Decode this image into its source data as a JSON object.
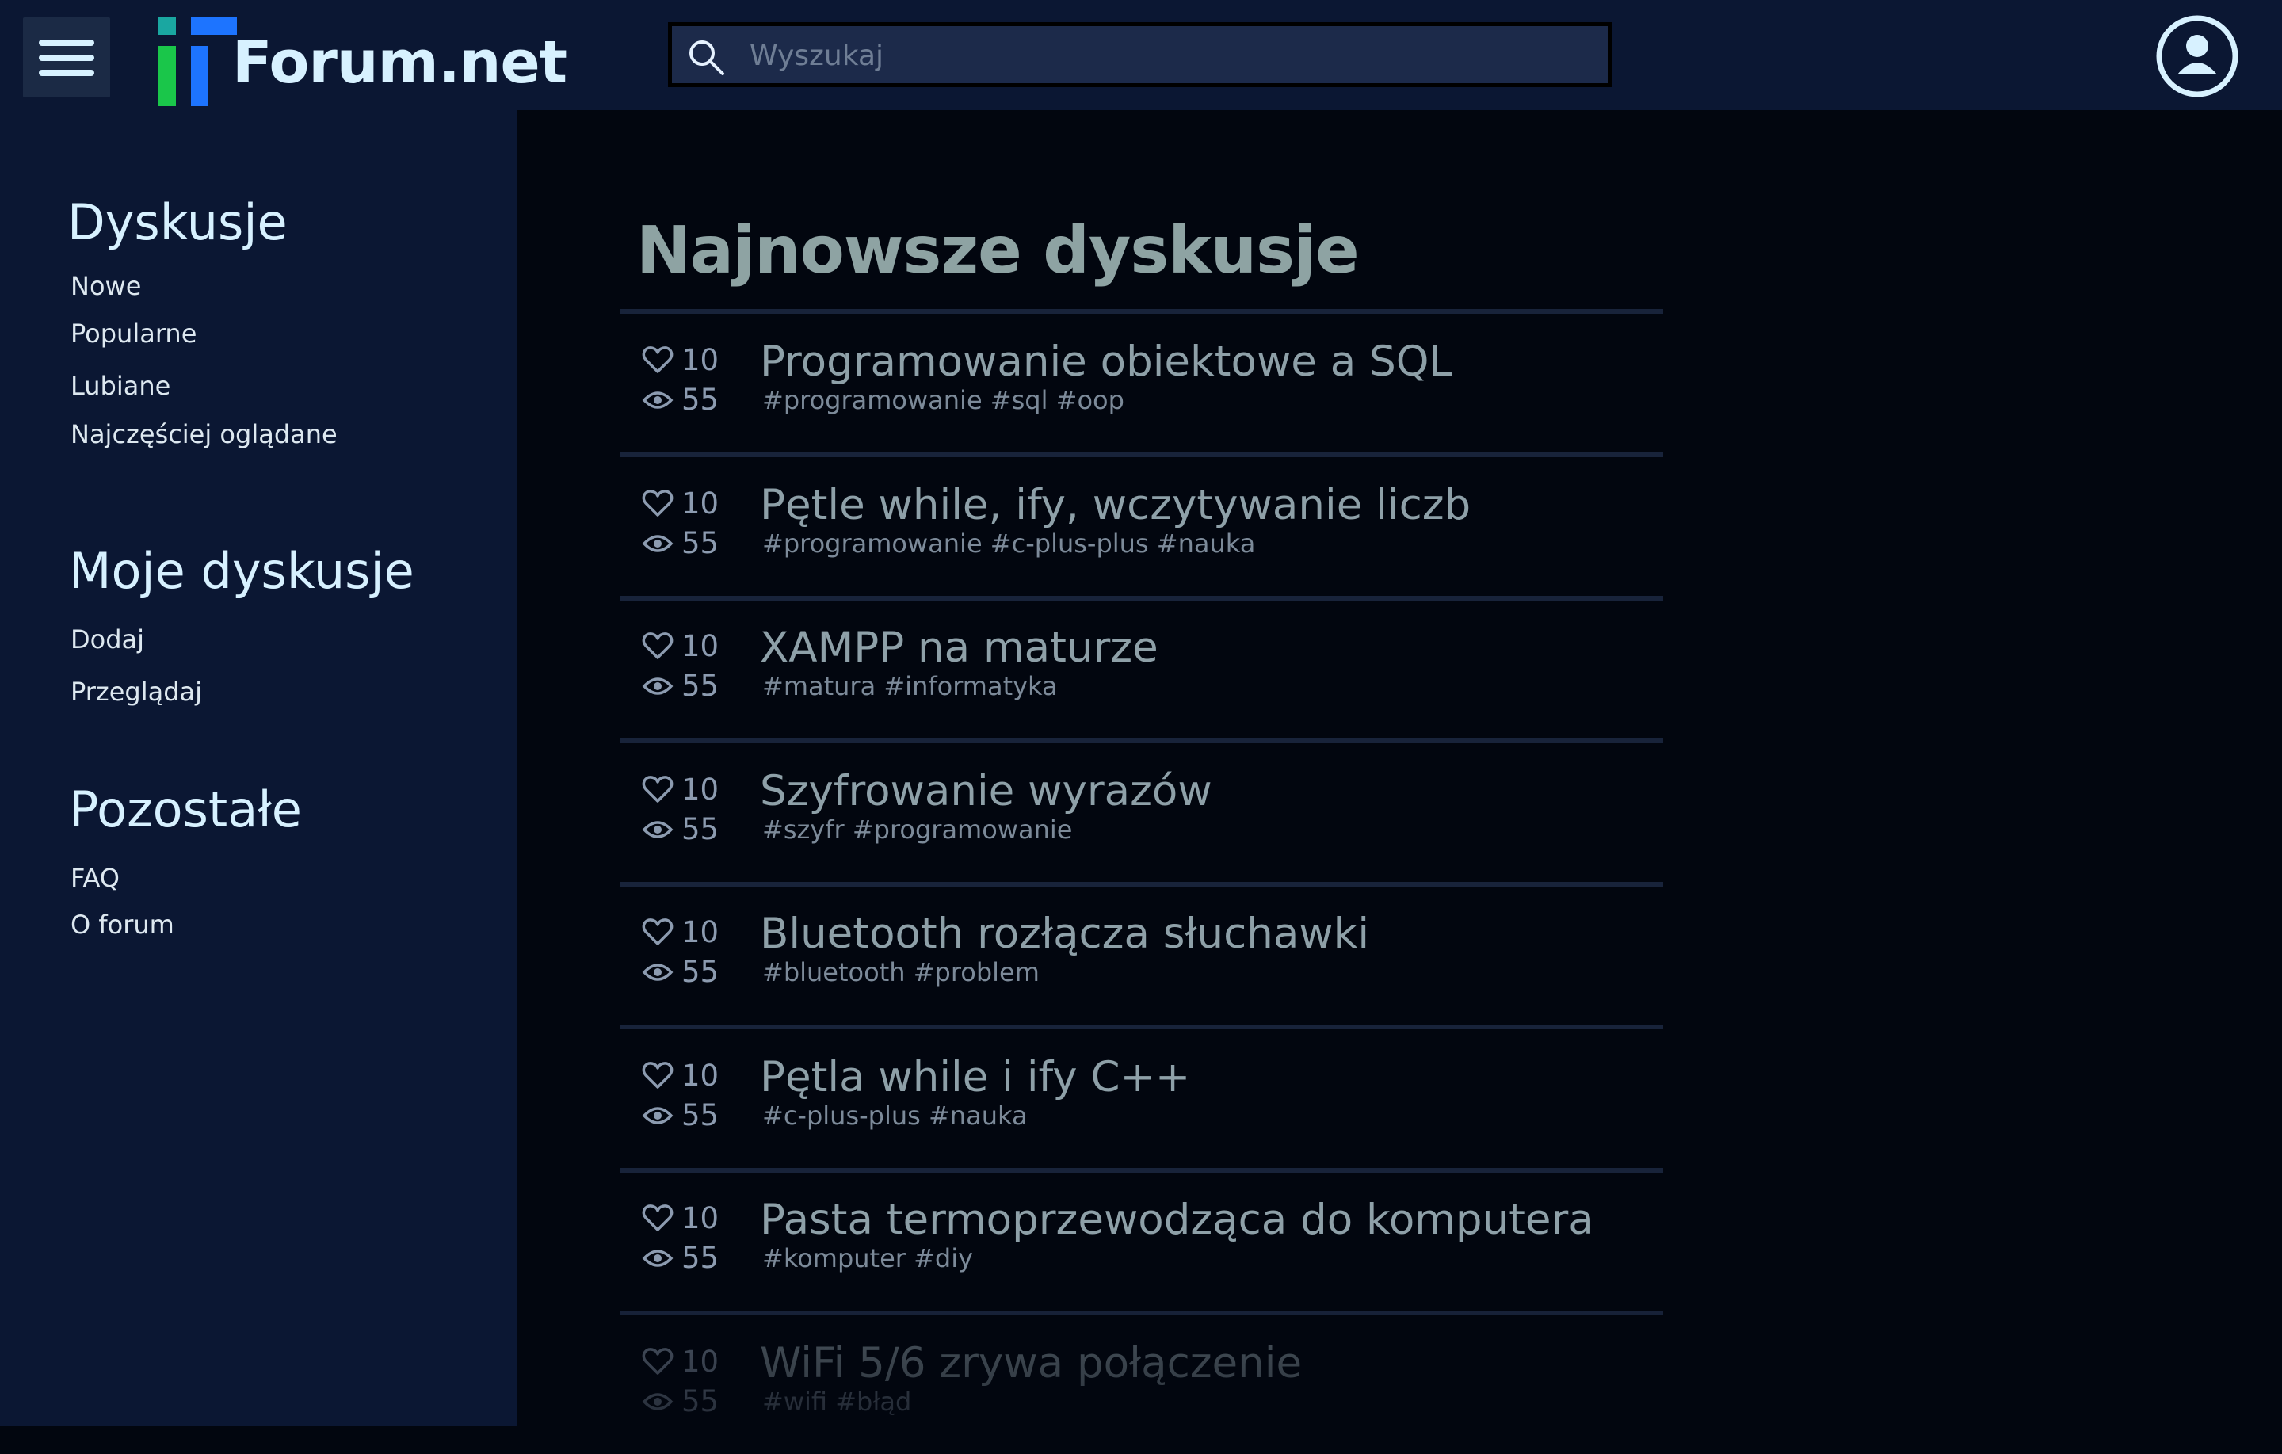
{
  "header": {
    "logo_text": "Forum.net",
    "search_placeholder": "Wyszukaj"
  },
  "sidebar": {
    "sections": [
      {
        "title": "Dyskusje",
        "links": [
          "Nowe",
          "Popularne",
          "Lubiane",
          "Najczęściej oglądane"
        ]
      },
      {
        "title": "Moje dyskusje",
        "links": [
          "Dodaj",
          "Przeglądaj"
        ]
      },
      {
        "title": "Pozostałe",
        "links": [
          "FAQ",
          "O forum"
        ]
      }
    ]
  },
  "main": {
    "title": "Najnowsze dyskusje",
    "discussions": [
      {
        "likes": "10",
        "views": "55",
        "title": "Programowanie obiektowe a SQL",
        "tags": "#programowanie #sql #oop"
      },
      {
        "likes": "10",
        "views": "55",
        "title": "Pętle while, ify, wczytywanie liczb",
        "tags": "#programowanie #c-plus-plus #nauka"
      },
      {
        "likes": "10",
        "views": "55",
        "title": "XAMPP na maturze",
        "tags": "#matura #informatyka"
      },
      {
        "likes": "10",
        "views": "55",
        "title": "Szyfrowanie wyrazów",
        "tags": "#szyfr #programowanie"
      },
      {
        "likes": "10",
        "views": "55",
        "title": "Bluetooth rozłącza słuchawki",
        "tags": "#bluetooth #problem"
      },
      {
        "likes": "10",
        "views": "55",
        "title": "Pętla while i ify C++",
        "tags": "#c-plus-plus #nauka"
      },
      {
        "likes": "10",
        "views": "55",
        "title": "Pasta termoprzewodząca do komputera",
        "tags": "#komputer #diy"
      },
      {
        "likes": "10",
        "views": "55",
        "title": "WiFi 5/6 zrywa połączenie",
        "tags": "#wifi #błąd"
      }
    ]
  },
  "colors": {
    "header_bg": "#0b1733",
    "main_bg": "#02060f",
    "accent_light": "#d7f1ff",
    "logo_green": "#1ac64a",
    "logo_teal": "#1aa7a1",
    "logo_blue": "#1d74ff"
  }
}
